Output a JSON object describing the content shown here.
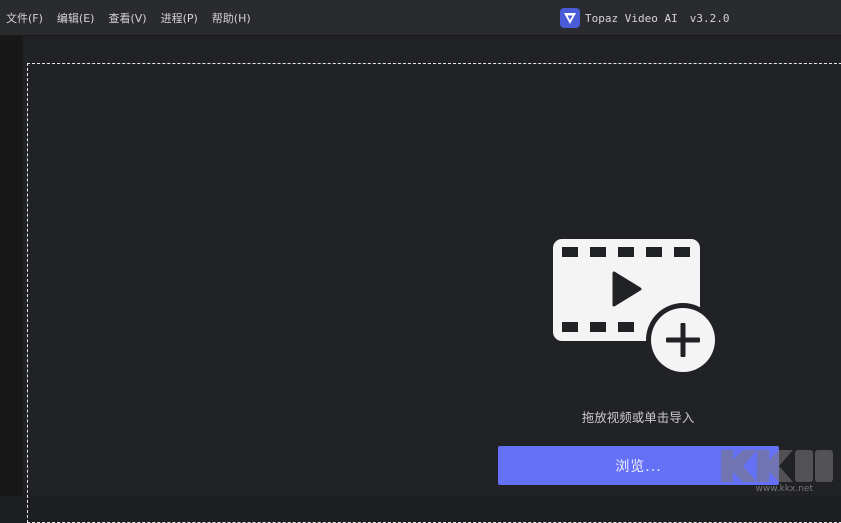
{
  "menubar": {
    "items": [
      {
        "label": "文件(F)"
      },
      {
        "label": "编辑(E)"
      },
      {
        "label": "查看(V)"
      },
      {
        "label": "进程(P)"
      },
      {
        "label": "帮助(H)"
      }
    ]
  },
  "app": {
    "title": "Topaz Video AI",
    "version": "v3.2.0",
    "logo_icon": "topaz-logo-icon",
    "logo_color": "#4a5bd8"
  },
  "dropzone": {
    "icon": "video-add-icon",
    "hint": "拖放视频或单击导入",
    "browse_label": "浏览..."
  },
  "watermark": {
    "text": "www.kkx.net"
  },
  "colors": {
    "accent": "#6470f5",
    "background": "#212226",
    "menubar": "#2a2b2e"
  }
}
